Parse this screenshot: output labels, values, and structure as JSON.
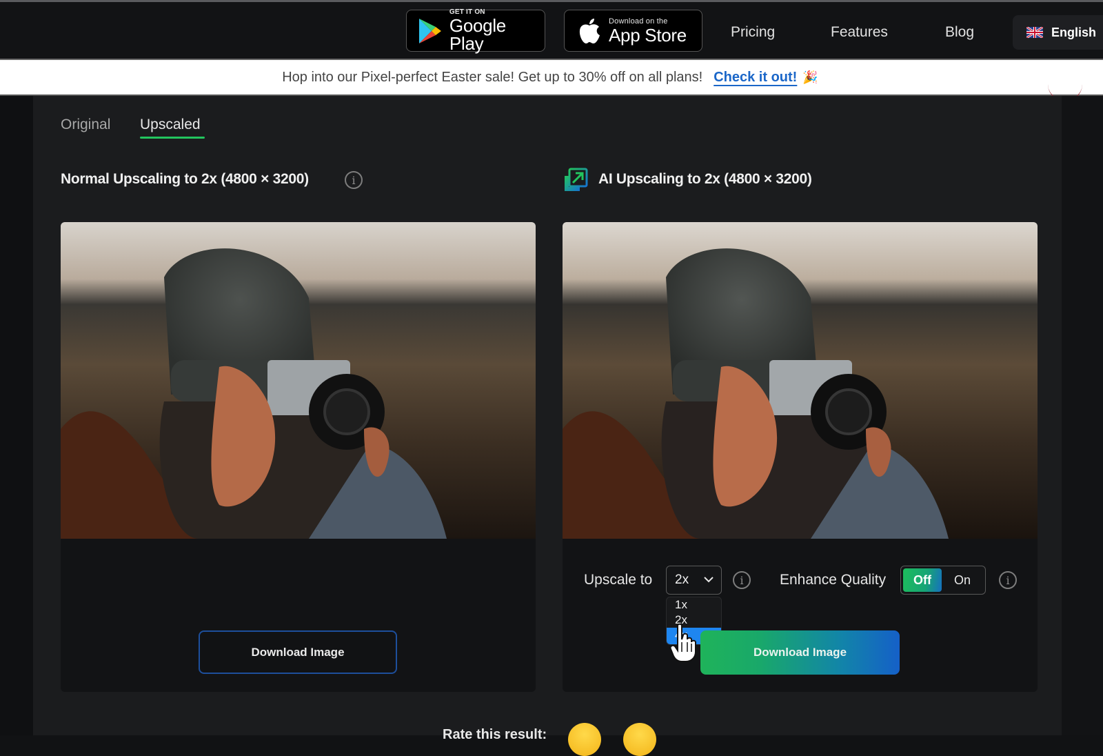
{
  "nav": {
    "google_play": {
      "small": "GET IT ON",
      "big": "Google Play",
      "icon": "google-play-icon"
    },
    "app_store": {
      "small": "Download on the",
      "big": "App Store",
      "icon": "apple-icon"
    },
    "links": [
      "Pricing",
      "Features",
      "Blog"
    ],
    "language": {
      "label": "English",
      "icon": "uk-flag-icon"
    }
  },
  "banner": {
    "text": "Hop into our Pixel-perfect Easter sale! Get up to 30% off on all plans!",
    "link": "Check it out!",
    "emoji": "🎉"
  },
  "tabs": [
    {
      "label": "Original",
      "active": false
    },
    {
      "label": "Upscaled",
      "active": true
    }
  ],
  "left_panel": {
    "title": "Normal Upscaling to 2x (4800 × 3200)",
    "download_label": "Download Image"
  },
  "right_panel": {
    "title": "AI Upscaling to 2x (4800 × 3200)",
    "upscale_label": "Upscale to",
    "upscale_value": "2x",
    "upscale_options": [
      "1x",
      "2x",
      "4x"
    ],
    "highlighted_option": "4x",
    "enhance_label": "Enhance Quality",
    "toggle_off": "Off",
    "toggle_on": "On",
    "toggle_state": "Off",
    "download_label": "Download Image"
  },
  "rating": {
    "text": "Rate this result:"
  },
  "colors": {
    "accent_green": "#22c55e",
    "accent_blue": "#1e86f0",
    "link_blue": "#1a66c8"
  }
}
